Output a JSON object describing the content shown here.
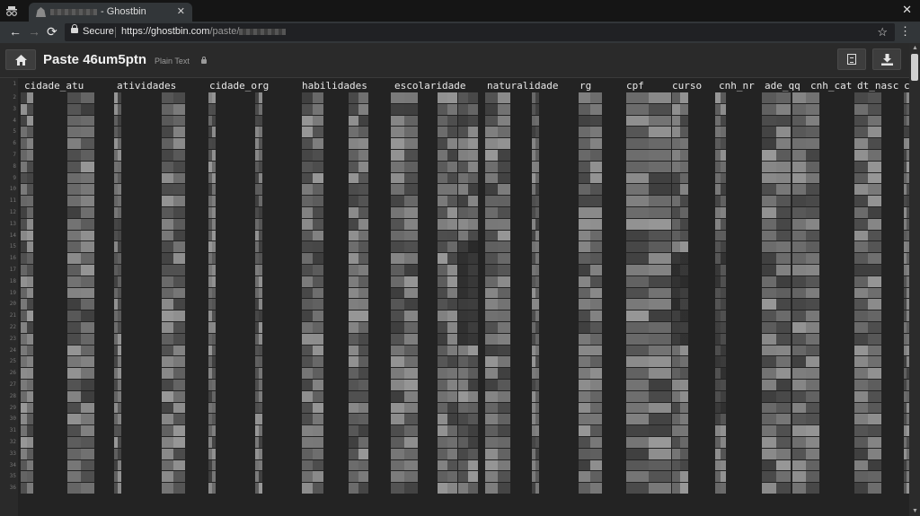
{
  "browser": {
    "tab_title": "- Ghostbin",
    "tab_close": "✕",
    "window_close": "✕",
    "back": "←",
    "forward": "→",
    "reload": "⟳",
    "secure_label": "Secure",
    "url_domain": "https://ghostbin.com",
    "url_path": "/paste/",
    "bookmark": "☆",
    "menu": "⋮",
    "icons": [
      "incognito-icon",
      "ghost-favicon",
      "lock-icon",
      "star-icon",
      "kebab-menu-icon"
    ]
  },
  "paste": {
    "title": "Paste 46um5ptn",
    "language": "Plain Text",
    "icons": [
      "home-icon",
      "raw-document-icon",
      "download-icon",
      "lock-icon"
    ]
  },
  "table": {
    "headers": [
      "cidade_atu",
      "atividades",
      "cidade_org",
      "habilidades",
      "escolaridade",
      "naturalidade",
      "rg",
      "cpf",
      "curso",
      "cnh_nr",
      "ade_qq",
      "cnh_cat",
      "dt_nasc",
      "c"
    ],
    "line_numbers": [
      "2",
      "3",
      "4",
      "5",
      "6",
      "7",
      "8",
      "9",
      "10",
      "11",
      "12",
      "13",
      "14",
      "15",
      "16",
      "17",
      "18",
      "19",
      "20",
      "21",
      "22",
      "23",
      "24",
      "25",
      "26",
      "27",
      "28",
      "29",
      "30",
      "31",
      "32",
      "33",
      "34",
      "35",
      "36"
    ],
    "gutter_first": "1"
  },
  "colors": {
    "background": "#232323",
    "header_bg": "#2a2a2a",
    "text": "#e8e8e8",
    "blur_light": "#8c8c8c",
    "blur_dark": "#4a4a4a"
  }
}
